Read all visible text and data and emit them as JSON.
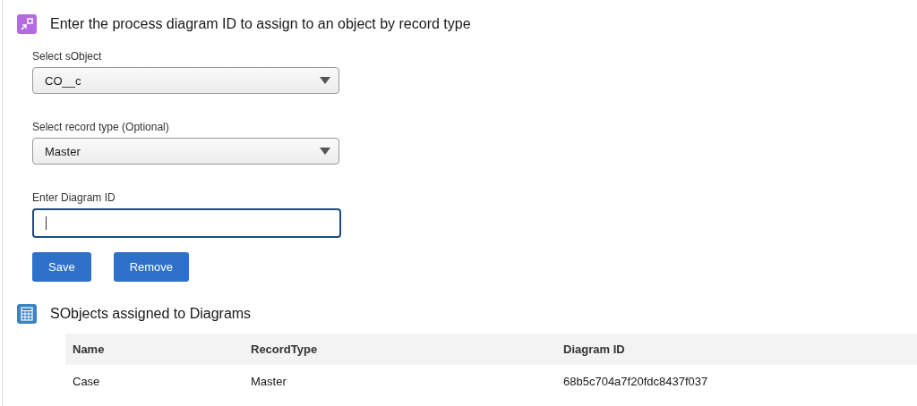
{
  "form": {
    "title": "Enter the process diagram ID to assign to an object by record type",
    "selects": [
      {
        "label": "Select sObject",
        "value": "CO__c"
      },
      {
        "label": "Select record type (Optional)",
        "value": "Master"
      }
    ],
    "diagram_field": {
      "label": "Enter Diagram ID",
      "focused": true
    },
    "buttons": [
      "Save",
      "Remove"
    ]
  },
  "table_section": {
    "title": "SObjects assigned to Diagrams",
    "table": {
      "columns": [
        "Name",
        "RecordType",
        "Diagram ID"
      ],
      "rows": [
        [
          "Case",
          "Master",
          "68b5c704a7f20fdc8437f037"
        ]
      ]
    }
  }
}
